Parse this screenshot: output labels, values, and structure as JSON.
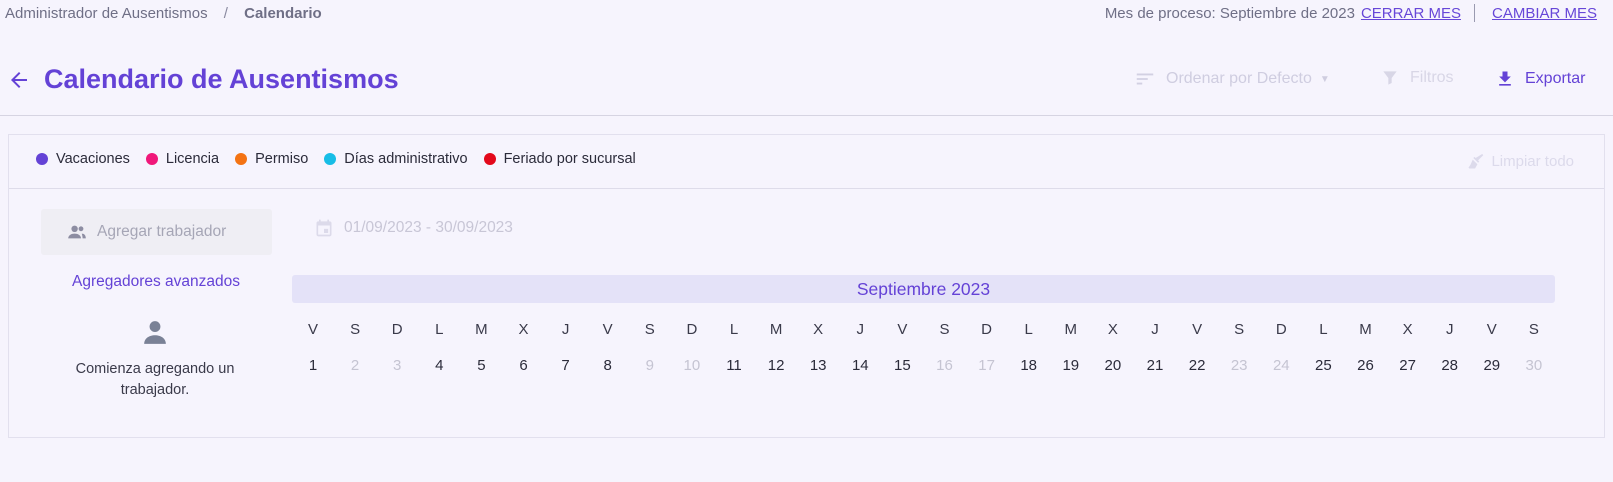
{
  "breadcrumb": {
    "parent": "Administrador de Ausentismos",
    "separator": "/",
    "current": "Calendario"
  },
  "process": {
    "label": "Mes de proceso: Septiembre de 2023",
    "close_month": "CERRAR MES",
    "change_month": "CAMBIAR MES"
  },
  "header": {
    "title": "Calendario de Ausentismos",
    "sort_label": "Ordenar por Defecto",
    "filters_label": "Filtros",
    "export_label": "Exportar"
  },
  "legend": {
    "items": [
      {
        "label": "Vacaciones",
        "color": "#6442d6"
      },
      {
        "label": "Licencia",
        "color": "#f0177a"
      },
      {
        "label": "Permiso",
        "color": "#f47313"
      },
      {
        "label": "Días administrativo",
        "color": "#17bde6"
      },
      {
        "label": "Feriado por sucursal",
        "color": "#e3081b"
      }
    ],
    "clear_label": "Limpiar todo"
  },
  "controls": {
    "add_worker_label": "Agregar trabajador",
    "date_range": "01/09/2023 - 30/09/2023",
    "advanced_label": "Agregadores avanzados",
    "empty_message": "Comienza agregando un trabajador."
  },
  "calendar": {
    "month_label": "Septiembre 2023",
    "weekdays": [
      "V",
      "S",
      "D",
      "L",
      "M",
      "X",
      "J",
      "V",
      "S",
      "D",
      "L",
      "M",
      "X",
      "J",
      "V",
      "S",
      "D",
      "L",
      "M",
      "X",
      "J",
      "V",
      "S",
      "D",
      "L",
      "M",
      "X",
      "J",
      "V",
      "S"
    ],
    "days": [
      "1",
      "2",
      "3",
      "4",
      "5",
      "6",
      "7",
      "8",
      "9",
      "10",
      "11",
      "12",
      "13",
      "14",
      "15",
      "16",
      "17",
      "18",
      "19",
      "20",
      "21",
      "22",
      "23",
      "24",
      "25",
      "26",
      "27",
      "28",
      "29",
      "30"
    ],
    "weekend_days": [
      "2",
      "3",
      "9",
      "10",
      "16",
      "17",
      "23",
      "24",
      "30"
    ]
  }
}
